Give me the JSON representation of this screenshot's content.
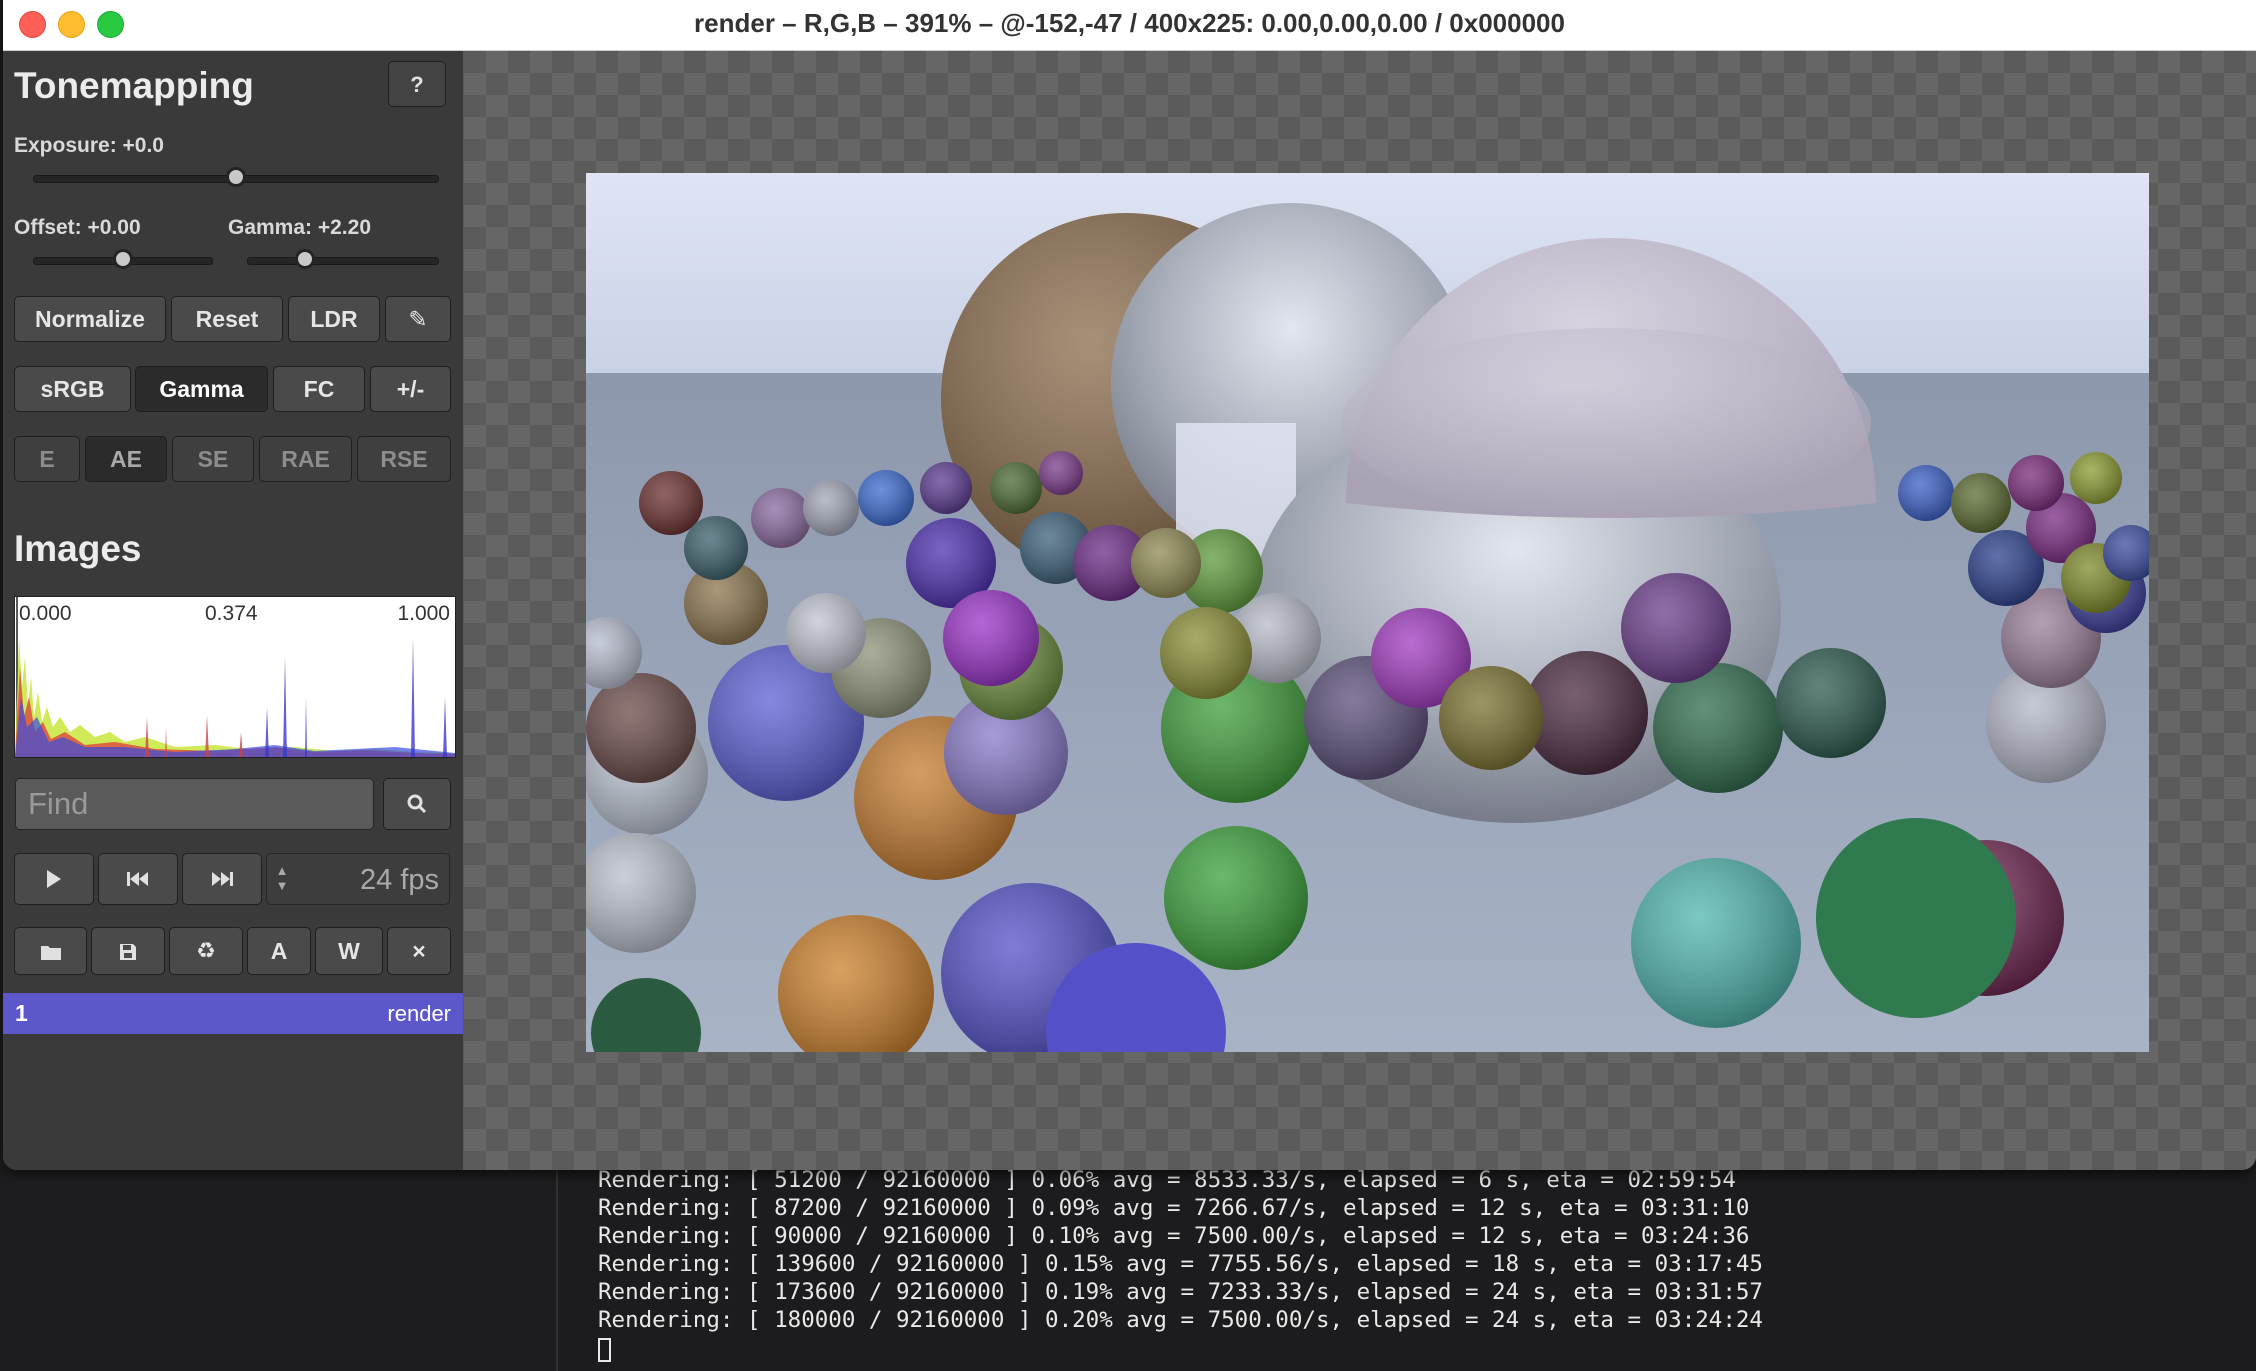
{
  "window": {
    "title": "render – R,G,B – 391% – @-152,-47 / 400x225: 0.00,0.00,0.00 / 0x000000"
  },
  "tonemapping": {
    "title": "Tonemapping",
    "help_label": "?",
    "exposure_label": "Exposure: +0.0",
    "exposure_value": 0.0,
    "offset_label": "Offset: +0.00",
    "offset_value": 0.0,
    "gamma_label": "Gamma: +2.20",
    "gamma_value": 2.2,
    "buttons_row1": [
      "Normalize",
      "Reset",
      "LDR",
      "✎"
    ],
    "buttons_row2": [
      "sRGB",
      "Gamma",
      "FC",
      "+/-"
    ],
    "buttons_row2_active": "Gamma",
    "buttons_row3": [
      "E",
      "AE",
      "SE",
      "RAE",
      "RSE"
    ],
    "buttons_row3_active": "AE"
  },
  "images": {
    "title": "Images",
    "histogram": {
      "min_label": "0.000",
      "mid_label": "0.374",
      "max_label": "1.000"
    },
    "find_placeholder": "Find",
    "search_icon": "search-icon",
    "playback": {
      "play_icon": "play-icon",
      "prev_icon": "skip-back-icon",
      "next_icon": "skip-forward-icon",
      "fps": "24 fps"
    },
    "file_buttons": [
      "folder-icon",
      "save-icon",
      "reload-icon",
      "A",
      "W",
      "×"
    ],
    "list": [
      {
        "index": "1",
        "name": "render",
        "selected": true
      }
    ]
  },
  "terminal": {
    "lines": [
      "Rendering: [ 51200 / 92160000 ] 0.06% avg = 8533.33/s, elapsed = 6 s, eta = 02:59:54",
      "Rendering: [ 87200 / 92160000 ] 0.09% avg = 7266.67/s, elapsed = 12 s, eta = 03:31:10",
      "Rendering: [ 90000 / 92160000 ] 0.10% avg = 7500.00/s, elapsed = 12 s, eta = 03:24:36",
      "Rendering: [ 139600 / 92160000 ] 0.15% avg = 7755.56/s, elapsed = 18 s, eta = 03:17:45",
      "Rendering: [ 173600 / 92160000 ] 0.19% avg = 7233.33/s, elapsed = 24 s, eta = 03:31:57",
      "Rendering: [ 180000 / 92160000 ] 0.20% avg = 7500.00/s, elapsed = 24 s, eta = 03:24:24"
    ]
  },
  "colors": {
    "accent": "#5c57cb",
    "panel": "#3a3a3b",
    "canvas": "#5b5b5b"
  }
}
